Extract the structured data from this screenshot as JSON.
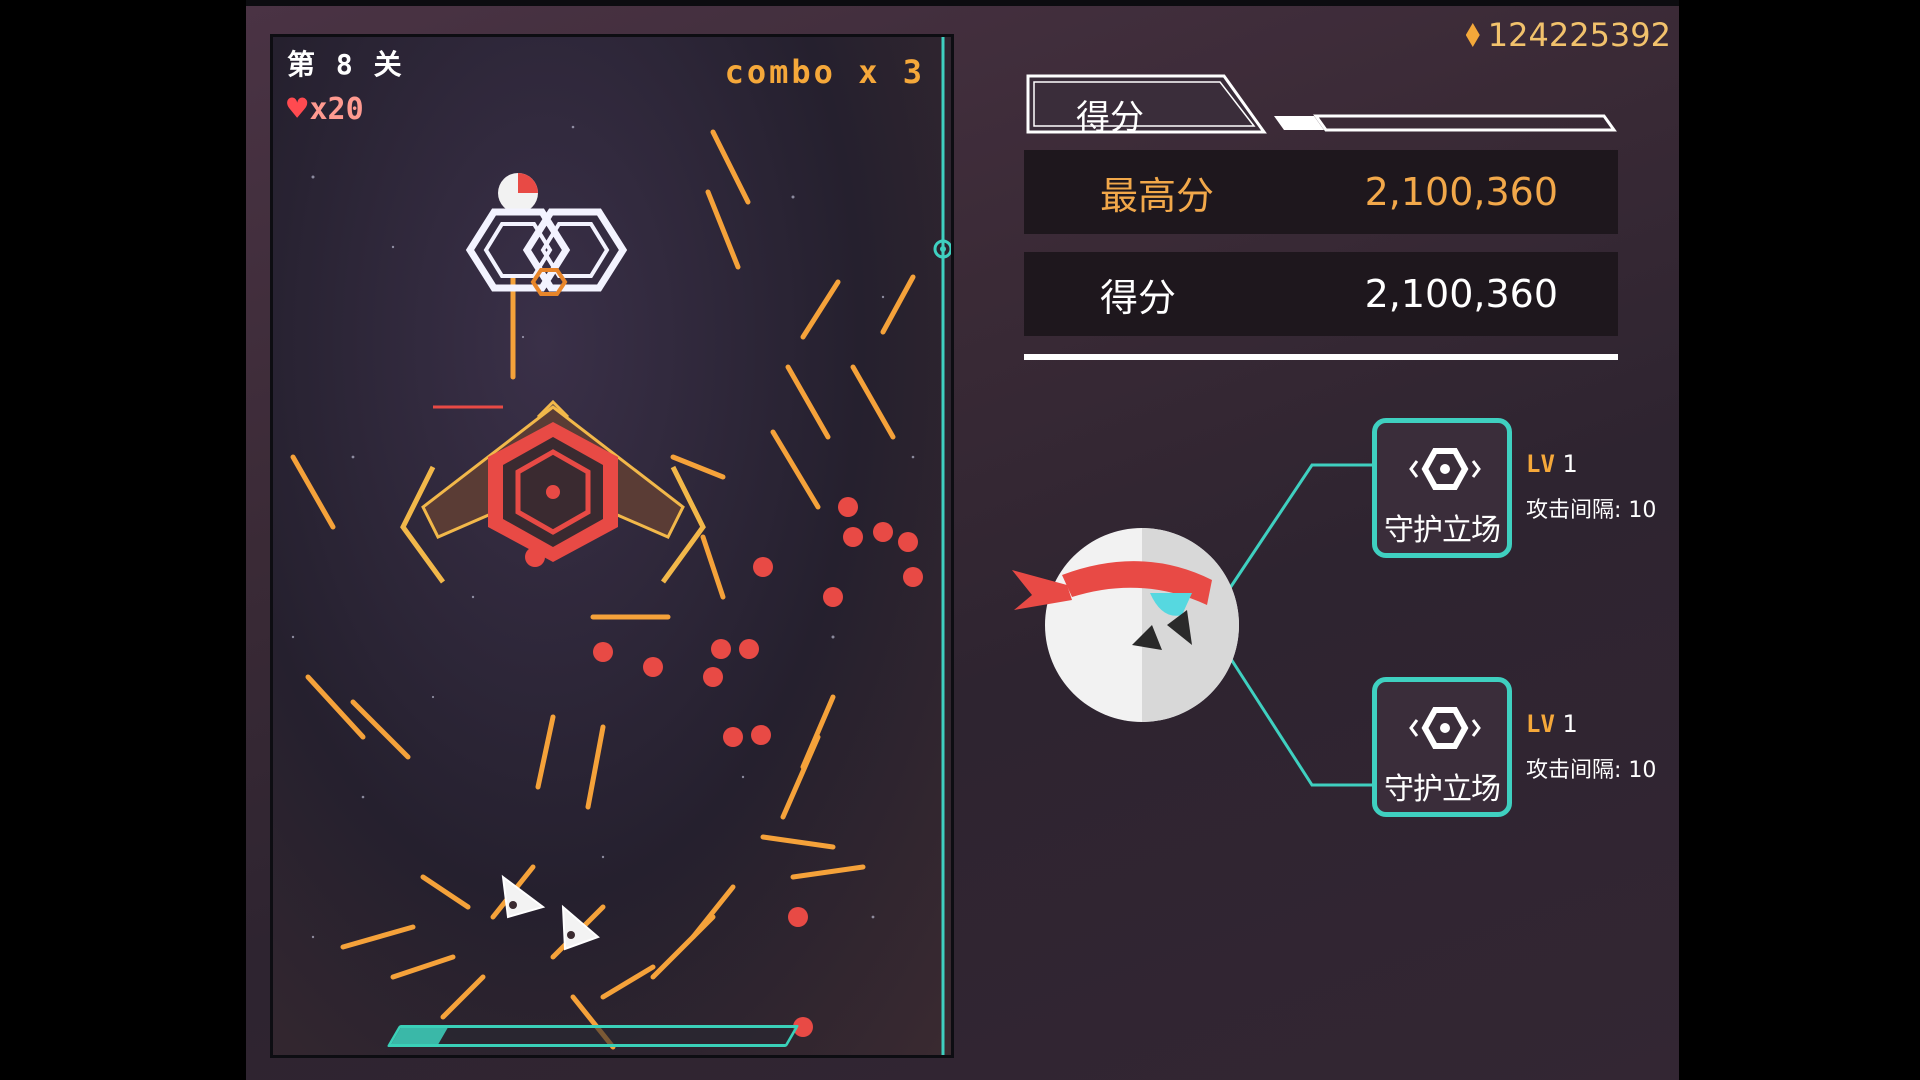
{
  "currency": {
    "icon": "gem-icon",
    "amount": "124225392"
  },
  "game": {
    "level_label": "第 8 关",
    "lives_label": "x20",
    "combo_label": "combo x 3"
  },
  "score_panel": {
    "tab_label": "得分",
    "best": {
      "label": "最高分",
      "value": "2,100,360"
    },
    "score": {
      "label": "得分",
      "value": "2,100,360"
    }
  },
  "skills": [
    {
      "name": "守护立场",
      "lv_prefix": "LV",
      "lv_value": "1",
      "interval": "攻击间隔: 10",
      "icon": "hexagon-shield-icon"
    },
    {
      "name": "守护立场",
      "lv_prefix": "LV",
      "lv_value": "1",
      "interval": "攻击间隔: 10",
      "icon": "hexagon-shield-icon"
    }
  ],
  "colors": {
    "accent_orange": "#f5a83a",
    "teal": "#3fd0c0",
    "enemy_red": "#e84a45",
    "panel_dark": "#1e171d"
  }
}
